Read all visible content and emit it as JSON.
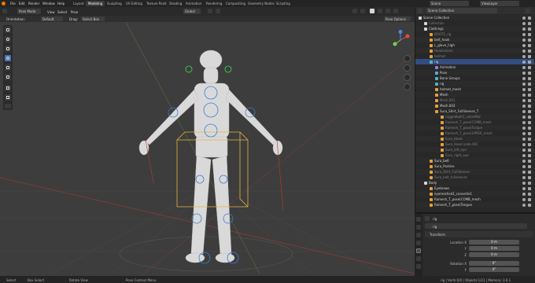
{
  "topbar": {
    "menus": [
      "File",
      "Edit",
      "Render",
      "Window",
      "Help"
    ],
    "workspaces": [
      "Layout",
      "Modeling",
      "Sculpting",
      "UV Editing",
      "Texture Paint",
      "Shading",
      "Animation",
      "Rendering",
      "Compositing",
      "Geometry Nodes",
      "Scripting"
    ],
    "active_workspace": "Modeling",
    "scene": "Scene",
    "view_layer": "ViewLayer"
  },
  "viewport_header": {
    "mode": "Pose Mode",
    "menus": [
      "View",
      "Select",
      "Pose"
    ],
    "transform_orientation": "Global",
    "pose_options": "Pose Options"
  },
  "tool_settings": {
    "orientation_label": "Orientation:",
    "orientation_value": "Default",
    "drag_label": "Drag:",
    "drag_value": "Select Box"
  },
  "toolbar": {
    "tools": [
      "select-box-icon",
      "cursor-icon",
      "move-icon",
      "rotate-icon",
      "scale-icon",
      "transform-icon",
      "annotate-icon",
      "measure-icon",
      "relax-pose-icon"
    ]
  },
  "outliner": {
    "header": "Scene Collection",
    "rows": [
      {
        "label": "Scene Collection",
        "indent": 0,
        "icon": "collection",
        "dim": false,
        "sel": false
      },
      {
        "label": "Collection",
        "indent": 1,
        "icon": "collection",
        "dim": true,
        "sel": false
      },
      {
        "label": "Clothings",
        "indent": 1,
        "icon": "collection",
        "dim": false,
        "sel": false
      },
      {
        "label": "BOOTS_rig",
        "indent": 2,
        "icon": "mesh",
        "dim": true,
        "sel": false
      },
      {
        "label": "belt_hook",
        "indent": 2,
        "icon": "mesh",
        "dim": false,
        "sel": false
      },
      {
        "label": "L_glove_high",
        "indent": 2,
        "icon": "mesh",
        "dim": false,
        "sel": false
      },
      {
        "label": "Headcellars",
        "indent": 2,
        "icon": "mesh",
        "dim": true,
        "sel": false
      },
      {
        "label": "helmet",
        "indent": 2,
        "icon": "mesh",
        "dim": true,
        "sel": false
      },
      {
        "label": "rig",
        "indent": 2,
        "icon": "armature",
        "dim": false,
        "sel": true
      },
      {
        "label": "Animation",
        "indent": 3,
        "icon": "anim",
        "dim": false,
        "sel": false
      },
      {
        "label": "Pose",
        "indent": 3,
        "icon": "pose",
        "dim": false,
        "sel": false
      },
      {
        "label": "Bone Groups",
        "indent": 3,
        "icon": "bones",
        "dim": false,
        "sel": false
      },
      {
        "label": "rig",
        "indent": 3,
        "icon": "armature",
        "dim": false,
        "sel": false
      },
      {
        "label": "helmet_mesh",
        "indent": 3,
        "icon": "mesh",
        "dim": false,
        "sel": false
      },
      {
        "label": "Mesh",
        "indent": 3,
        "icon": "mesh",
        "dim": false,
        "sel": false
      },
      {
        "label": "Mesh.001",
        "indent": 3,
        "icon": "mesh",
        "dim": true,
        "sel": false
      },
      {
        "label": "Mesh.003",
        "indent": 3,
        "icon": "mesh",
        "dim": false,
        "sel": false
      },
      {
        "label": "Sura_Shirt_FullSleeves_T",
        "indent": 3,
        "icon": "mesh",
        "dim": false,
        "sel": false
      },
      {
        "label": "ruggedbelt1_collarMid",
        "indent": 4,
        "icon": "mesh",
        "dim": true,
        "sel": false
      },
      {
        "label": "Ramesh_T_pose(COMB_mesh",
        "indent": 4,
        "icon": "mesh",
        "dim": true,
        "sel": false
      },
      {
        "label": "Ramesh_T_pose(Torque",
        "indent": 4,
        "icon": "mesh",
        "dim": true,
        "sel": false
      },
      {
        "label": "Ramesh_T_pose(UPPER_mesh",
        "indent": 4,
        "icon": "mesh",
        "dim": true,
        "sel": false
      },
      {
        "label": "Suro_Head",
        "indent": 4,
        "icon": "mesh",
        "dim": true,
        "sel": false
      },
      {
        "label": "Suro_Head.node.001",
        "indent": 4,
        "icon": "mesh",
        "dim": true,
        "sel": false
      },
      {
        "label": "Suro_left_eye",
        "indent": 4,
        "icon": "mesh",
        "dim": true,
        "sel": false
      },
      {
        "label": "Suro_right_eye",
        "indent": 4,
        "icon": "mesh",
        "dim": true,
        "sel": false
      },
      {
        "label": "Sura_belt",
        "indent": 2,
        "icon": "mesh",
        "dim": false,
        "sel": false
      },
      {
        "label": "Sura_Panties",
        "indent": 2,
        "icon": "mesh",
        "dim": false,
        "sel": false
      },
      {
        "label": "Sura_Shirt_FullSleeves",
        "indent": 2,
        "icon": "mesh",
        "dim": true,
        "sel": false
      },
      {
        "label": "Sura_belt_fullsleeves",
        "indent": 2,
        "icon": "mesh",
        "dim": true,
        "sel": false
      },
      {
        "label": "Body",
        "indent": 1,
        "icon": "collection",
        "dim": false,
        "sel": false
      },
      {
        "label": "Eyebrows",
        "indent": 2,
        "icon": "mesh",
        "dim": false,
        "sel": false
      },
      {
        "label": "eyemeshed1_converte1",
        "indent": 2,
        "icon": "mesh",
        "dim": false,
        "sel": false
      },
      {
        "label": "Ramesh_T_pose(COMB_mesh",
        "indent": 2,
        "icon": "mesh",
        "dim": false,
        "sel": false
      },
      {
        "label": "Ramesh_T_pose(Tongue",
        "indent": 2,
        "icon": "mesh",
        "dim": false,
        "sel": false
      }
    ]
  },
  "properties": {
    "object_name": "rig",
    "data_name": "rig",
    "panel": "Transform",
    "fields": [
      {
        "label": "Location X",
        "value": "0 m"
      },
      {
        "label": "Y",
        "value": "0 m"
      },
      {
        "label": "Z",
        "value": "0 m"
      },
      {
        "label": "Rotation X",
        "value": "0°"
      },
      {
        "label": "Y",
        "value": "0°"
      }
    ]
  },
  "statusbar": {
    "select": "Select",
    "box_select": "Box Select",
    "rotate_view": "Rotate View",
    "context_menu": "Pose Context Menu",
    "stats": "rig | Verts:0/0 | Objects:1/21 | Memory: 3.0.1"
  }
}
